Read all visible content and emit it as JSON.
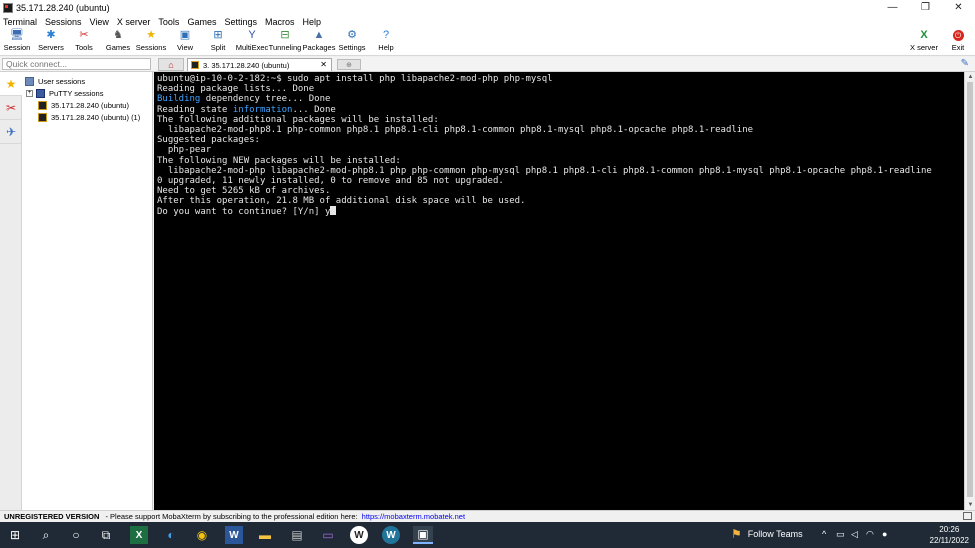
{
  "window": {
    "title": "35.171.28.240 (ubuntu)",
    "minimize_glyph": "—",
    "maximize_glyph": "❐",
    "close_glyph": "✕"
  },
  "menu": [
    "Terminal",
    "Sessions",
    "View",
    "X server",
    "Tools",
    "Games",
    "Settings",
    "Macros",
    "Help"
  ],
  "toolbar": {
    "items": [
      {
        "label": "Session",
        "icon": "session-icon",
        "glyph": "🖥",
        "color": "#3b6db3"
      },
      {
        "label": "Servers",
        "icon": "servers-icon",
        "glyph": "✱",
        "color": "#2a7fd4"
      },
      {
        "label": "Tools",
        "icon": "tools-icon",
        "glyph": "✂",
        "color": "#cc2b2b"
      },
      {
        "label": "Games",
        "icon": "games-icon",
        "glyph": "♞",
        "color": "#555555"
      },
      {
        "label": "Sessions",
        "icon": "sessions-star-icon",
        "glyph": "★",
        "color": "#f0b400"
      },
      {
        "label": "View",
        "icon": "view-icon",
        "glyph": "▣",
        "color": "#2f6fb5"
      },
      {
        "label": "Split",
        "icon": "split-icon",
        "glyph": "⊞",
        "color": "#2f6fb5"
      },
      {
        "label": "MultiExec",
        "icon": "multiexec-icon",
        "glyph": "Y",
        "color": "#2f4fa8"
      },
      {
        "label": "Tunneling",
        "icon": "tunneling-icon",
        "glyph": "⊟",
        "color": "#3a8a3a"
      },
      {
        "label": "Packages",
        "icon": "packages-icon",
        "glyph": "▲",
        "color": "#4a6fa5"
      },
      {
        "label": "Settings",
        "icon": "settings-icon",
        "glyph": "⚙",
        "color": "#2f6fb5"
      },
      {
        "label": "Help",
        "icon": "help-icon",
        "glyph": "?",
        "color": "#2a7fd4"
      }
    ],
    "xserver_label": "X server",
    "exit_label": "Exit"
  },
  "quick_connect": {
    "placeholder": "Quick connect..."
  },
  "tabs": {
    "session_tab": "3. 35.171.28.240 (ubuntu)",
    "close_glyph": "✕",
    "new_tab_glyph": "⊕",
    "home_glyph": "⌂"
  },
  "sidebar": {
    "root": "User sessions",
    "expander": "+",
    "putty": "PuTTY sessions",
    "items": [
      "35.171.28.240 (ubuntu)",
      "35.171.28.240 (ubuntu) (1)"
    ],
    "strip_glyphs": [
      "★",
      "✂",
      "✈"
    ]
  },
  "terminal": {
    "lines": [
      {
        "pre": "ubuntu@ip-10-0-2-182:~$ sudo apt install php libapache2-mod-php php-mysql",
        "hl": "",
        "post": ""
      },
      {
        "pre": "Reading package lists... Done",
        "hl": "",
        "post": ""
      },
      {
        "pre": "",
        "hl": "Building",
        "post": " dependency tree... Done"
      },
      {
        "pre": "Reading state ",
        "hl": "information",
        "post": "... Done"
      },
      {
        "pre": "The following additional packages will be installed:",
        "hl": "",
        "post": ""
      },
      {
        "pre": "  libapache2-mod-php8.1 php-common php8.1 php8.1-cli php8.1-common php8.1-mysql php8.1-opcache php8.1-readline",
        "hl": "",
        "post": ""
      },
      {
        "pre": "Suggested packages:",
        "hl": "",
        "post": ""
      },
      {
        "pre": "  php-pear",
        "hl": "",
        "post": ""
      },
      {
        "pre": "The following NEW packages will be installed:",
        "hl": "",
        "post": ""
      },
      {
        "pre": "  libapache2-mod-php libapache2-mod-php8.1 php php-common php-mysql php8.1 php8.1-cli php8.1-common php8.1-mysql php8.1-opcache php8.1-readline",
        "hl": "",
        "post": ""
      },
      {
        "pre": "0 upgraded, 11 newly installed, 0 to remove and 85 not upgraded.",
        "hl": "",
        "post": ""
      },
      {
        "pre": "Need to get 5265 kB of archives.",
        "hl": "",
        "post": ""
      },
      {
        "pre": "After this operation, 21.8 MB of additional disk space will be used.",
        "hl": "",
        "post": ""
      },
      {
        "pre": "Do you want to continue? [Y/n] y",
        "hl": "",
        "post": ""
      }
    ],
    "colors": {
      "fg": "#e6e6e6",
      "highlight": "#3fa4ff",
      "bg": "#000000"
    }
  },
  "status": {
    "bold": "UNREGISTERED VERSION",
    "message": "-  Please support MobaXterm by subscribing to the professional edition here:",
    "link": "https://mobaxterm.mobatek.net"
  },
  "taskbar": {
    "follow_label": "Follow Teams",
    "time": "20:26",
    "date": "22/11/2022"
  }
}
